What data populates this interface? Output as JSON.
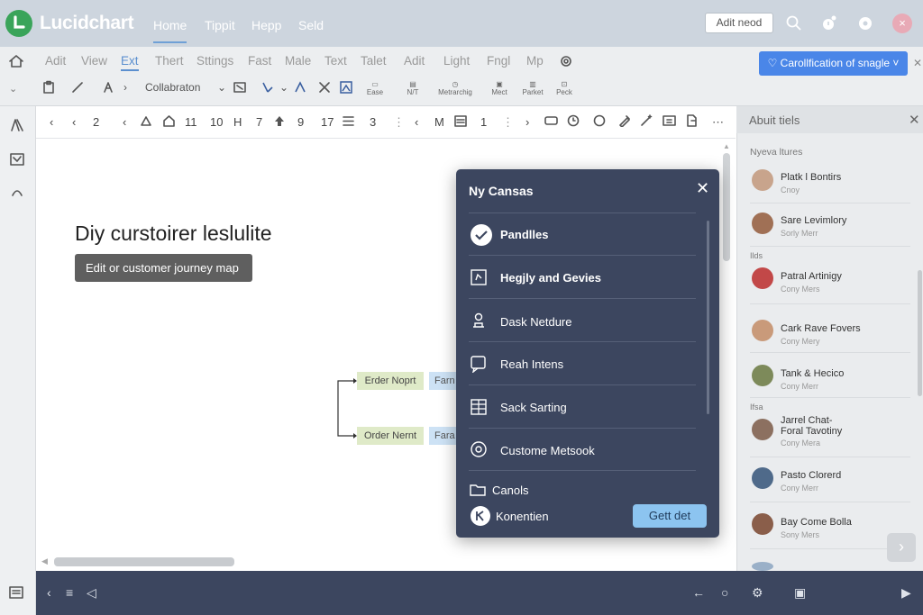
{
  "app": {
    "name": "Lucidchart",
    "brand_color": "#3aa45a",
    "accent": "#4a86e8"
  },
  "header": {
    "nav": [
      "Home",
      "Tippit",
      "Hepp",
      "Seld"
    ],
    "active_nav": "Home",
    "action_button": "Adit neod",
    "icons": [
      "search-icon",
      "notifications-icon",
      "help-icon",
      "avatar"
    ]
  },
  "menu": {
    "items": [
      "Adit",
      "View",
      "Ext",
      "Thert",
      "Sttings",
      "Fast",
      "Male",
      "Text",
      "Talet",
      "Adit",
      "Light",
      "Fngl",
      "Mp"
    ],
    "active": "Ext",
    "share_button": "Carollfication of snagle"
  },
  "toolbar": {
    "font_dropdown": "Collabraton",
    "small_labels": [
      "Ease",
      "N/T",
      "Metrarchig",
      "Mect",
      "Parket",
      "Peck"
    ]
  },
  "format": {
    "items": [
      "‹",
      "‹",
      "2",
      "‹",
      "11",
      "10",
      "H",
      "7",
      "9",
      "17",
      "3",
      "‹",
      "M",
      "1",
      "›"
    ]
  },
  "canvas": {
    "title": "Diy curstoirer leslulite",
    "subtitle_button": "Edit or customer journey map",
    "shapes": [
      {
        "label": "Erder Noprt",
        "tag": "Farn"
      },
      {
        "label": "Order Nernt",
        "tag": "Fara"
      }
    ]
  },
  "modal": {
    "title": "Ny Cansas",
    "items": [
      {
        "label": "Pandlles",
        "bold": true,
        "icon": "check-circle-icon"
      },
      {
        "label": "Hegjly and Gevies",
        "bold": true,
        "icon": "edit-box-icon"
      },
      {
        "label": "Dask Netdure",
        "bold": false,
        "icon": "stamp-icon"
      },
      {
        "label": "Reah Intens",
        "bold": false,
        "icon": "message-icon"
      },
      {
        "label": "Sack Sarting",
        "bold": false,
        "icon": "document-grid-icon"
      },
      {
        "label": "Custome Metsook",
        "bold": false,
        "icon": "gear-badge-icon"
      },
      {
        "label": "Canols",
        "bold": false,
        "icon": "folder-icon"
      }
    ],
    "footer_label": "Konentien",
    "cta": "Gett det"
  },
  "panel": {
    "title": "Abuit tiels",
    "section1": "Nyeva ltures",
    "section2": "Ilds",
    "section3": "Ifsa",
    "people": [
      {
        "name": "Platk l Bontirs",
        "sub": "Cnoy"
      },
      {
        "name": "Sare Levimlory",
        "sub": "Sorly Merr"
      },
      {
        "name": "Patral Artinigy",
        "sub": "Cony Mers"
      },
      {
        "name": "Cark Rave Fovers",
        "sub": "Cony Mery"
      },
      {
        "name": "Tank & Hecico",
        "sub": "Cony Merr"
      },
      {
        "name": "Jarrel Chat-",
        "name2": "Foral Tavotiny",
        "sub": "Cony Mera"
      },
      {
        "name": "Pasto Clorerd",
        "sub": "Cony Merr"
      },
      {
        "name": "Bay Come Bolla",
        "sub": "Sony Mers"
      }
    ]
  }
}
